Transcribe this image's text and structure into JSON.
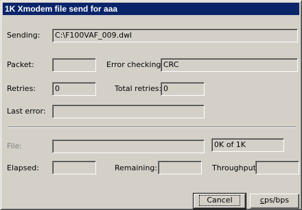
{
  "window": {
    "title": "1K Xmodem file send for aaa"
  },
  "sending": {
    "label": "Sending:",
    "value": "C:\\F100VAF_009.dwl"
  },
  "packet": {
    "label": "Packet:",
    "value": ""
  },
  "error_checking": {
    "label": "Error checking:",
    "value": "CRC"
  },
  "retries": {
    "label": "Retries:",
    "value": "0"
  },
  "total_retries": {
    "label": "Total retries:",
    "value": "0"
  },
  "last_error": {
    "label": "Last error:",
    "value": ""
  },
  "file": {
    "label": "File:",
    "progress": 0,
    "status": "0K of 1K"
  },
  "elapsed": {
    "label": "Elapsed:",
    "value": ""
  },
  "remaining": {
    "label": "Remaining:",
    "value": ""
  },
  "throughput": {
    "label": "Throughput:",
    "value": ""
  },
  "buttons": {
    "cancel": "Cancel",
    "cps_accel": "c",
    "cps_rest": "ps/bps"
  }
}
